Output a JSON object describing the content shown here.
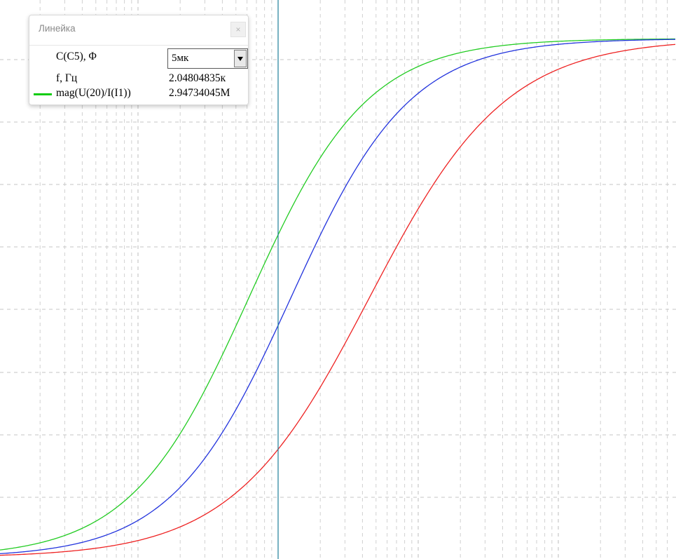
{
  "ruler": {
    "title": "Линейка",
    "close_label": "×",
    "param_label": "C(C5), Φ",
    "param_value": "5мк",
    "freq_label": "f, Гц",
    "freq_value": "2.04804835к",
    "series_label": "mag(U(20)/I(I1))",
    "series_value": "2.94734045M",
    "series_color": "#11cc11"
  },
  "chart_data": {
    "type": "line",
    "title": "",
    "xlabel": "",
    "ylabel": "",
    "x_scale": "log",
    "grid": true,
    "axis_tick_labels_visible": false,
    "cursor_color": "#1e7f9a",
    "series": [
      {
        "color": "#22cc22",
        "x_mid_decades": 1.79,
        "slope_per_decade": 2.37
      },
      {
        "color": "#2233dd",
        "x_mid_decades": 2.09,
        "slope_per_decade": 2.35
      },
      {
        "color": "#ee2222",
        "x_mid_decades": 2.65,
        "slope_per_decade": 2.05
      }
    ],
    "cursor_x_decades": 2.0
  }
}
